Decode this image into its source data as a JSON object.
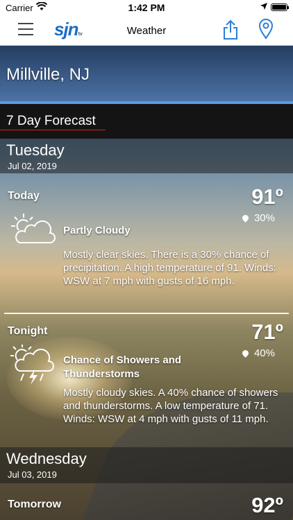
{
  "status_bar": {
    "carrier": "Carrier",
    "time": "1:42 PM"
  },
  "nav": {
    "title": "Weather",
    "logo": "sjn",
    "logo_sub": "tv",
    "icons": [
      "menu-icon",
      "share-icon",
      "location-pin-icon"
    ],
    "accent": "#1a6fc4"
  },
  "location": "Millville, NJ",
  "forecast_label": "7 Day Forecast",
  "days": [
    {
      "name": "Tuesday",
      "date": "Jul 02, 2019",
      "periods": [
        {
          "name": "Today",
          "temp": "91º",
          "precip": "30%",
          "icon": "partly-cloudy-icon",
          "condition": "Partly Cloudy",
          "description": "Mostly clear skies. There is a 30% chance of precipitation.  A high temperature of 91.  Winds: WSW at 7 mph with gusts of 16 mph."
        },
        {
          "name": "Tonight",
          "temp": "71º",
          "precip": "40%",
          "icon": "thunderstorm-icon",
          "condition": "Chance of Showers and Thunderstorms",
          "description": "Mostly cloudy skies.  A 40% chance of showers and thunderstorms.  A low temperature of 71.  Winds: WSW at 4 mph with gusts of 11 mph."
        }
      ]
    },
    {
      "name": "Wednesday",
      "date": "Jul 03, 2019",
      "periods": [
        {
          "name": "Tomorrow",
          "temp": "92º"
        }
      ]
    }
  ]
}
